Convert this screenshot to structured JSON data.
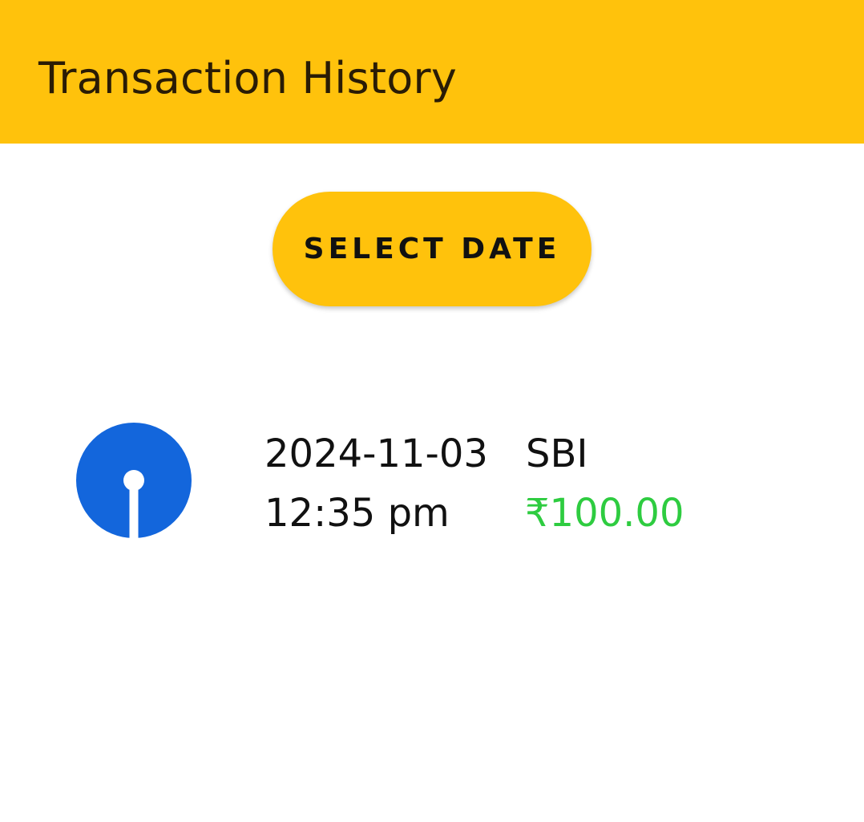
{
  "app_bar": {
    "title": "Transaction History",
    "color": "#FFC20C"
  },
  "select_date_button": {
    "label": "SELECT DATE"
  },
  "transactions": [
    {
      "date": "2024-11-03",
      "time": "12:35 pm",
      "bank": "SBI",
      "amount": "₹100.00",
      "amount_color": "#2ecc40",
      "icon": "sbi-logo-icon",
      "icon_color": "#1366DC"
    }
  ]
}
